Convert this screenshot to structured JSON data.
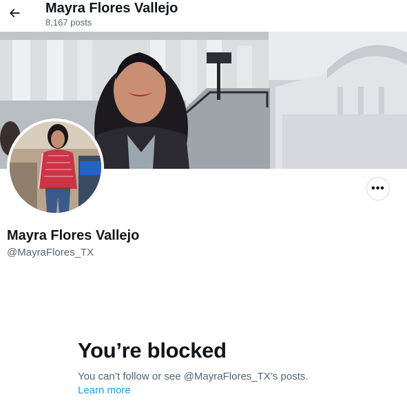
{
  "header": {
    "back_icon": "arrow-left-icon",
    "name": "Mayra Flores Vallejo",
    "post_count": "8,167",
    "posts_label": "posts"
  },
  "profile": {
    "name": "Mayra Flores Vallejo",
    "handle": "@MayraFlores_TX",
    "more_icon": "more-horizontal-icon",
    "more_label": "•••"
  },
  "blocked": {
    "title": "You’re blocked",
    "message": "You can’t follow or see @MayraFlores_TX’s posts.",
    "link_label": "Learn more"
  },
  "colors": {
    "text_primary": "#0f1419",
    "text_secondary": "#536471",
    "link": "#1d9bf0",
    "border": "#cfd9de"
  }
}
